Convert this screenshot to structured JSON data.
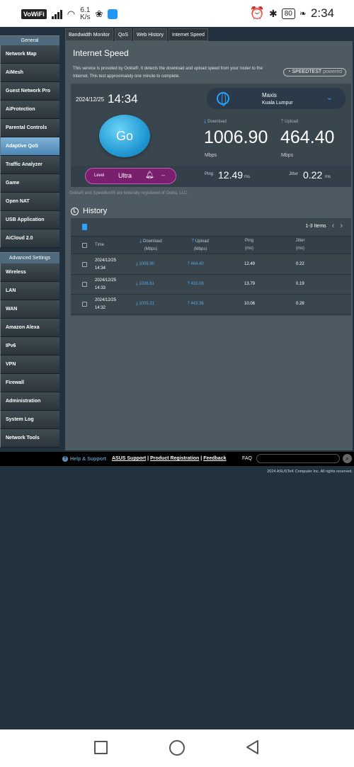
{
  "statusbar": {
    "vowifi": "VoWiFi",
    "speed_value": "6.1",
    "speed_unit": "K/s",
    "battery": "80",
    "time": "2:34"
  },
  "tabs": [
    "Bandwidth Monitor",
    "QoS",
    "Web History",
    "Internet Speed"
  ],
  "sidebar": {
    "general_header": "General",
    "general_items": [
      "Network Map",
      "AiMesh",
      "Guest Network Pro",
      "AiProtection",
      "Parental Controls",
      "Adaptive QoS",
      "Traffic Analyzer",
      "Game",
      "Open NAT",
      "USB Application",
      "AiCloud 2.0"
    ],
    "active_item": "Adaptive QoS",
    "advanced_header": "Advanced Settings",
    "advanced_items": [
      "Wireless",
      "LAN",
      "WAN",
      "Amazon Alexa",
      "IPv6",
      "VPN",
      "Firewall",
      "Administration",
      "System Log",
      "Network Tools"
    ]
  },
  "speedtest": {
    "title": "Internet Speed",
    "description": "This service is provided by Ookla®. It detects the download and upload speed from your router to the Internet. This test approximately one minute to complete.",
    "badge": "SPEEDTEST",
    "badge_suffix": "powered",
    "date": "2024/12/25",
    "time": "14:34",
    "isp": "Maxis",
    "location": "Kuala Lumpur",
    "go_label": "Go",
    "download_label": "Download",
    "upload_label": "Upload",
    "download_value": "1006.90",
    "upload_value": "464.40",
    "unit": "Mbps",
    "level_label": "Level",
    "level_value": "Ultra",
    "level_extra": "--",
    "ping_label": "Ping",
    "ping_value": "12.49",
    "ping_unit": "ms",
    "jitter_label": "Jitter",
    "jitter_value": "0.22",
    "jitter_unit": "ms",
    "legal": "Ookla® and Speedtest® are federally registered of Ookla, LLC."
  },
  "history": {
    "title": "History",
    "items_count": "1-3 Items",
    "columns": {
      "time": "Time",
      "download": "Download",
      "download_unit": "(Mbps)",
      "upload": "Upload",
      "upload_unit": "(Mbps)",
      "ping": "Ping",
      "ping_unit": "(ms)",
      "jitter": "Jitter",
      "jitter_unit": "(ms)"
    },
    "rows": [
      {
        "date": "2024/12/25",
        "time": "14:34",
        "download": "1006.90",
        "upload": "464.40",
        "ping": "12.49",
        "jitter": "0.22"
      },
      {
        "date": "2024/12/25",
        "time": "14:33",
        "download": "1036.61",
        "upload": "433.08",
        "ping": "13.79",
        "jitter": "0.19"
      },
      {
        "date": "2024/12/25",
        "time": "14:32",
        "download": "1005.31",
        "upload": "443.36",
        "ping": "10.06",
        "jitter": "0.28"
      }
    ]
  },
  "footer": {
    "help": "Help & Support",
    "asus_support": "ASUS Support",
    "product_registration": "Product Registration",
    "feedback": "Feedback",
    "faq": "FAQ",
    "copyright": "2024 ASUSTeK Computer Inc. All rights reserved."
  },
  "colors": {
    "accent": "#29a3ff",
    "go_button": "#1f95d1",
    "level_pill": "#7a1f6d",
    "active_menu": "#5a93c0"
  }
}
